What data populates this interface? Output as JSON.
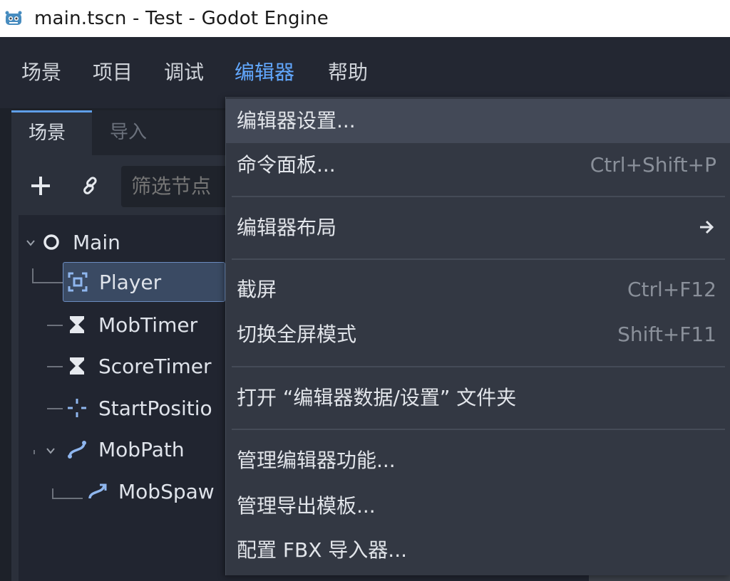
{
  "window": {
    "title": "main.tscn - Test - Godot Engine"
  },
  "menubar": {
    "items": [
      {
        "label": "场景"
      },
      {
        "label": "项目"
      },
      {
        "label": "调试"
      },
      {
        "label": "编辑器"
      },
      {
        "label": "帮助"
      }
    ],
    "active": "编辑器"
  },
  "scene_panel": {
    "tabs": [
      {
        "label": "场景"
      },
      {
        "label": "导入"
      }
    ],
    "filter_placeholder": "筛选节点",
    "tree": [
      {
        "label": "Main"
      },
      {
        "label": "Player"
      },
      {
        "label": "MobTimer"
      },
      {
        "label": "ScoreTimer"
      },
      {
        "label": "StartPositio"
      },
      {
        "label": "MobPath"
      },
      {
        "label": "MobSpaw"
      }
    ]
  },
  "editor_menu": {
    "items": [
      {
        "label": "编辑器设置...",
        "shortcut": ""
      },
      {
        "label": "命令面板...",
        "shortcut": "Ctrl+Shift+P"
      },
      {
        "label": "编辑器布局",
        "shortcut": ""
      },
      {
        "label": "截屏",
        "shortcut": "Ctrl+F12"
      },
      {
        "label": "切换全屏模式",
        "shortcut": "Shift+F11"
      },
      {
        "label": "打开 “编辑器数据/设置” 文件夹",
        "shortcut": ""
      },
      {
        "label": "管理编辑器功能...",
        "shortcut": ""
      },
      {
        "label": "管理导出模板...",
        "shortcut": ""
      },
      {
        "label": "配置 FBX 导入器...",
        "shortcut": ""
      }
    ]
  },
  "colors": {
    "accent": "#62a8ff",
    "menu_bg": "#333843",
    "selected_row": "#3a4a63"
  }
}
